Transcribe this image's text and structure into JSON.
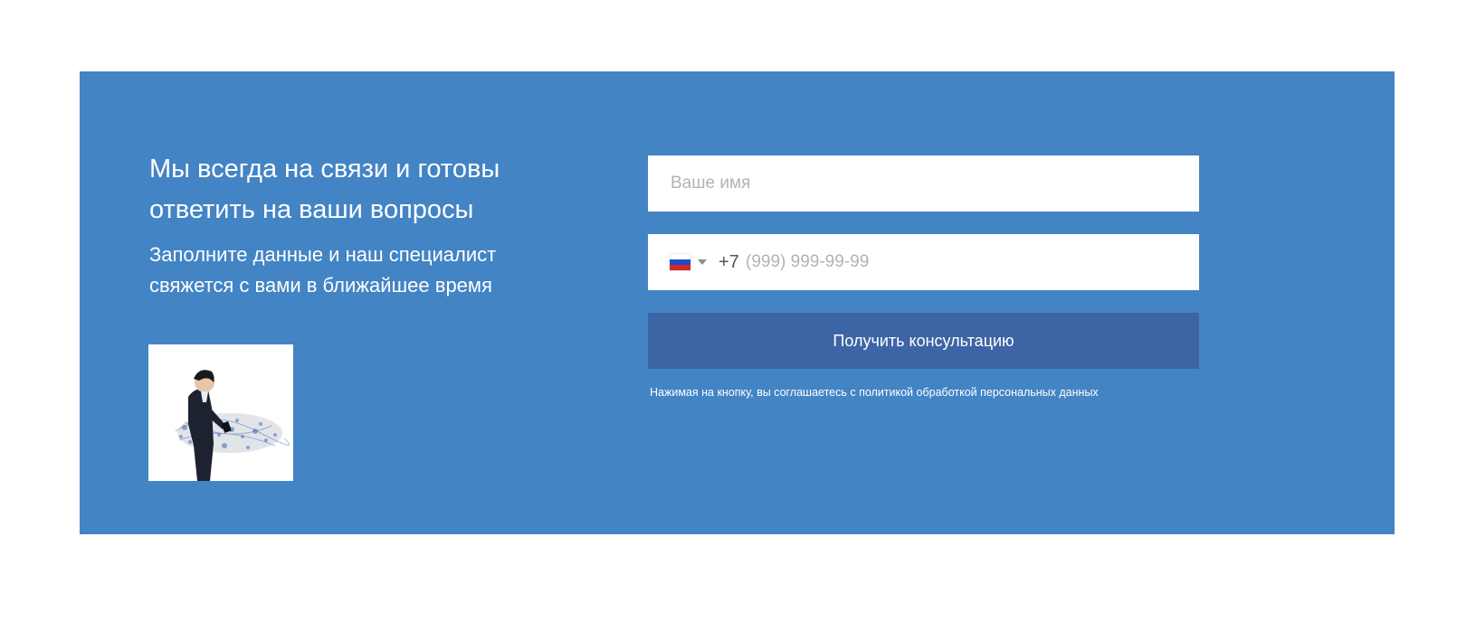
{
  "contact": {
    "heading": "Мы всегда на связи и готовы ответить на ваши вопросы",
    "subheading": "Заполните данные и наш специалист свяжется с вами в ближайшее время"
  },
  "form": {
    "name_placeholder": "Ваше имя",
    "country_icon": "russia-flag-icon",
    "phone_prefix": "+7",
    "phone_placeholder": "(999) 999-99-99",
    "submit_label": "Получить консультацию",
    "consent_text": "Нажимая на кнопку, вы соглашаетесь с политикой обработкой персональных данных"
  },
  "colors": {
    "banner_bg": "#4384c5",
    "button_bg": "#3d64a4",
    "text_light": "#ffffff",
    "placeholder": "#b3b3b3"
  }
}
